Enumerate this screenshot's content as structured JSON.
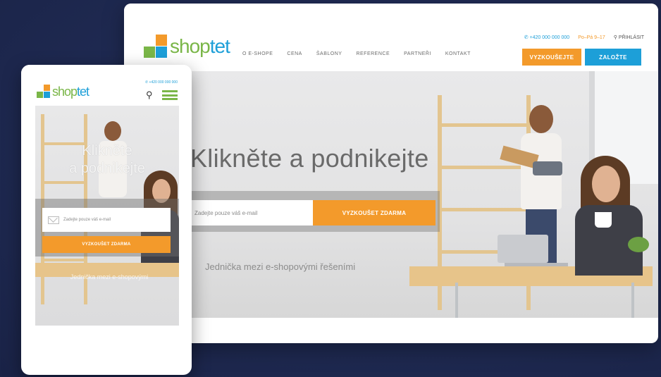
{
  "desktop": {
    "logo": {
      "part1": "shop",
      "part2": "tet"
    },
    "nav": [
      "O E-SHOPE",
      "CENA",
      "ŠABLONY",
      "REFERENCE",
      "PARTNEŘI",
      "KONTAKT"
    ],
    "phone": "+420 000 000 000",
    "hours": "Po–Pá 9–17",
    "login": "PŘIHLÁSIT",
    "try_button": "VYZKOUŠEJTE",
    "signup_button": "ZALOŽTE",
    "headline": "Klikněte a podnikejte",
    "email_placeholder": "Zadejte pouze váš e-mail",
    "cta": "VYZKOUŠET ZDARMA",
    "tagline": "Jednička mezi e-shopovými řešeními"
  },
  "mobile": {
    "logo": {
      "part1": "shop",
      "part2": "tet"
    },
    "phone": "+420 000 000 000",
    "headline_line1": "Klikněte",
    "headline_line2": "a podnikejte",
    "email_placeholder": "Zadejte pouze váš e-mail",
    "cta": "VYZKOUŠET ZDARMA",
    "tagline": "Jednička mezi e-shopovými"
  },
  "colors": {
    "background": "#1f2a52",
    "brand_green": "#7ab648",
    "brand_blue": "#1d9fd8",
    "brand_orange": "#f39a2b"
  },
  "icons": [
    "phone-icon",
    "user-icon",
    "search-icon",
    "hamburger-menu-icon",
    "mail-icon"
  ]
}
